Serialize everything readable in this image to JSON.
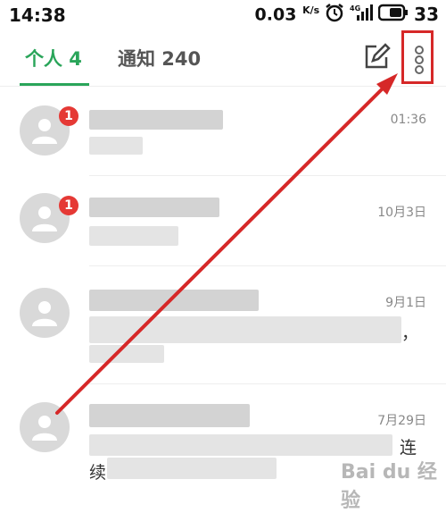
{
  "statusbar": {
    "time": "14:38",
    "speed": "0.03",
    "speed_unit": "K/s",
    "network": "4G",
    "battery": "33"
  },
  "tabs": [
    {
      "label": "个人 4",
      "active": true
    },
    {
      "label": "通知 240",
      "active": false
    }
  ],
  "conversations": [
    {
      "time": "01:36",
      "badge": "1"
    },
    {
      "time": "10月3日",
      "badge": "1"
    },
    {
      "time": "9月1日",
      "partial_text": "，"
    },
    {
      "time": "7月29日",
      "partial_text": "连",
      "partial_text_2": "续"
    }
  ],
  "watermark": "Bai du 经验",
  "colors": {
    "accent": "#2aa55a",
    "badge": "#e53935",
    "annotation": "#d62828"
  }
}
